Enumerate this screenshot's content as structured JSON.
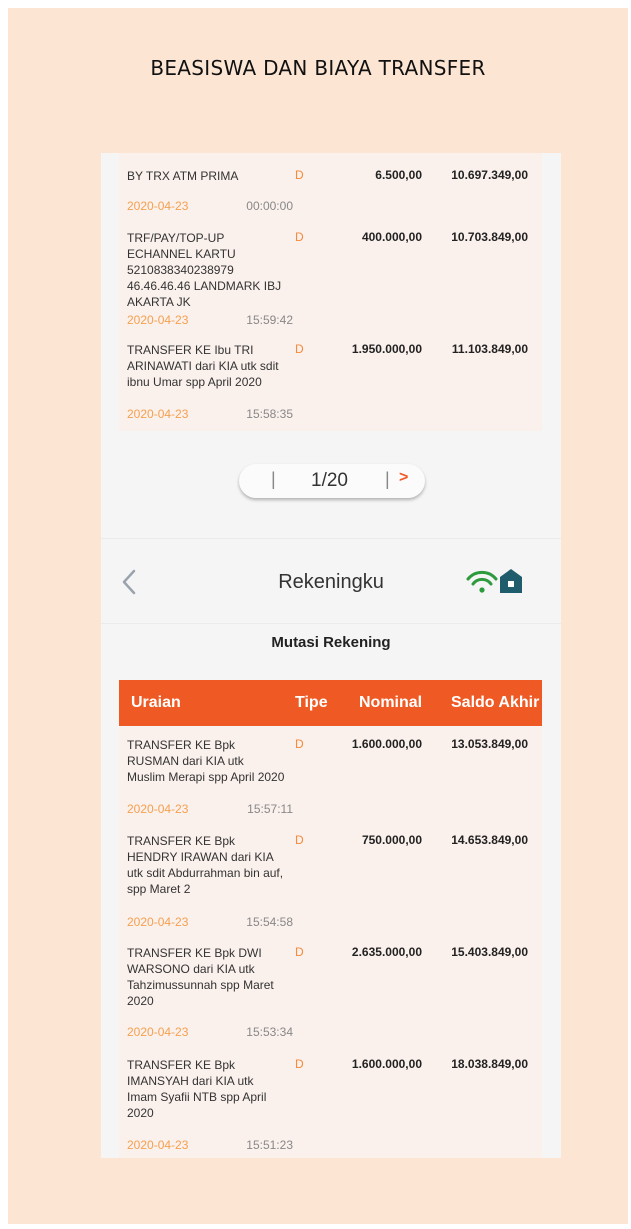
{
  "page_title": "BEASISWA DAN BIAYA TRANSFER",
  "top_transactions": [
    {
      "uraian": "BY TRX ATM PRIMA",
      "tipe": "D",
      "nominal": "6.500,00",
      "saldo": "10.697.349,00",
      "date": "2020-04-23",
      "time": "00:00:00"
    },
    {
      "uraian": "TRF/PAY/TOP-UP ECHANNEL KARTU 5210838340238979 46.46.46.46 LANDMARK IBJ AKARTA JK",
      "tipe": "D",
      "nominal": "400.000,00",
      "saldo": "10.703.849,00",
      "date": "2020-04-23",
      "time": "15:59:42"
    },
    {
      "uraian": "TRANSFER KE Ibu TRI ARINAWATI dari KIA utk sdit ibnu Umar spp April 2020",
      "tipe": "D",
      "nominal": "1.950.000,00",
      "saldo": "11.103.849,00",
      "date": "2020-04-23",
      "time": "15:58:35"
    }
  ],
  "pagination": {
    "separator": "|",
    "page": "1/20",
    "next": ">"
  },
  "app_bar": {
    "title": "Rekeningku"
  },
  "subtitle": "Mutasi Rekening",
  "table": {
    "headers": {
      "uraian": "Uraian",
      "tipe": "Tipe",
      "nominal": "Nominal",
      "saldo": "Saldo Akhir"
    },
    "rows": [
      {
        "uraian": "TRANSFER KE Bpk RUSMAN dari KIA utk Muslim Merapi spp April 2020",
        "tipe": "D",
        "nominal": "1.600.000,00",
        "saldo": "13.053.849,00",
        "date": "2020-04-23",
        "time": "15:57:11"
      },
      {
        "uraian": "TRANSFER KE Bpk HENDRY IRAWAN dari KIA utk sdit Abdurrahman bin auf, spp Maret 2",
        "tipe": "D",
        "nominal": "750.000,00",
        "saldo": "14.653.849,00",
        "date": "2020-04-23",
        "time": "15:54:58"
      },
      {
        "uraian": "TRANSFER KE Bpk DWI WARSONO dari KIA utk Tahzimussunnah spp Maret 2020",
        "tipe": "D",
        "nominal": "2.635.000,00",
        "saldo": "15.403.849,00",
        "date": "2020-04-23",
        "time": "15:53:34"
      },
      {
        "uraian": "TRANSFER KE Bpk IMANSYAH dari KIA utk Imam Syafii NTB spp April 2020",
        "tipe": "D",
        "nominal": "1.600.000,00",
        "saldo": "18.038.849,00",
        "date": "2020-04-23",
        "time": "15:51:23"
      }
    ]
  },
  "colors": {
    "accent": "#ef5a24",
    "date": "#f5a04f",
    "wifi": "#2e9a3e",
    "home": "#1f5d6c"
  },
  "icons": [
    "chevron-left-icon",
    "wifi-icon",
    "home-icon"
  ]
}
